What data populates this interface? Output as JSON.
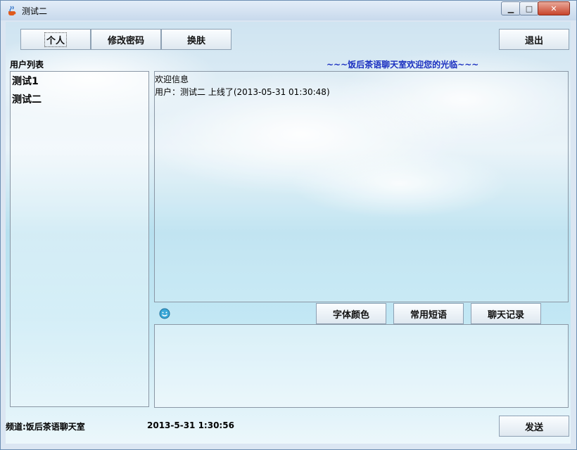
{
  "window": {
    "title": "测试二",
    "min_glyph": "▁",
    "max_glyph": "□",
    "close_glyph": "✕"
  },
  "toolbar": {
    "personal": "个人",
    "change_password": "修改密码",
    "skin": "换肤",
    "logout": "退出"
  },
  "user_list_label": "用户列表",
  "banner": "~~~饭后茶语聊天室欢迎您的光临~~~",
  "users": [
    "测试1",
    "测试二"
  ],
  "messages": [
    "欢迎信息",
    "用户：测试二  上线了(2013-05-31 01:30:48)"
  ],
  "input_tools": {
    "font_color": "字体颜色",
    "phrases": "常用短语",
    "history": "聊天记录"
  },
  "status": {
    "channel": "频道:饭后茶语聊天室",
    "clock": "2013-5-31 1:30:56"
  },
  "send": "发送",
  "colors": {
    "banner": "#1a2fc0",
    "close_button": "#c8442b"
  }
}
